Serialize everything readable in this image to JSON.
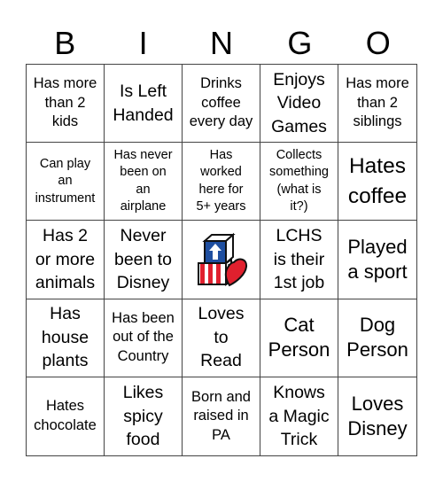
{
  "header": {
    "letters": [
      "B",
      "I",
      "N",
      "G",
      "O"
    ]
  },
  "free_space": {
    "icon": "toy-blocks-heart-logo",
    "colors": {
      "blue": "#1f4fa0",
      "red": "#e0202e",
      "white": "#ffffff",
      "outline": "#111111"
    }
  },
  "cells": [
    {
      "text": "Has more\nthan 2\nkids",
      "size": "m"
    },
    {
      "text": "Is Left\nHanded",
      "size": "l"
    },
    {
      "text": "Drinks\ncoffee\nevery day",
      "size": "m"
    },
    {
      "text": "Enjoys\nVideo\nGames",
      "size": "l"
    },
    {
      "text": "Has more\nthan 2\nsiblings",
      "size": "m"
    },
    {
      "text": "Can play\nan\ninstrument",
      "size": "s"
    },
    {
      "text": "Has never\nbeen on\nan\nairplane",
      "size": "s"
    },
    {
      "text": "Has\nworked\nhere for\n5+ years",
      "size": "s"
    },
    {
      "text": "Collects\nsomething\n(what is\nit?)",
      "size": "s"
    },
    {
      "text": "Hates\ncoffee",
      "size": "xxl"
    },
    {
      "text": "Has 2\nor more\nanimals",
      "size": "l"
    },
    {
      "text": "Never\nbeen to\nDisney",
      "size": "l"
    },
    {
      "text": "",
      "size": "free"
    },
    {
      "text": "LCHS\nis their\n1st job",
      "size": "l"
    },
    {
      "text": "Played\na sport",
      "size": "xl"
    },
    {
      "text": "Has\nhouse\nplants",
      "size": "l"
    },
    {
      "text": "Has been\nout of the\nCountry",
      "size": "m"
    },
    {
      "text": "Loves\nto\nRead",
      "size": "l"
    },
    {
      "text": "Cat\nPerson",
      "size": "xl"
    },
    {
      "text": "Dog\nPerson",
      "size": "xl"
    },
    {
      "text": "Hates\nchocolate",
      "size": "m"
    },
    {
      "text": "Likes\nspicy\nfood",
      "size": "l"
    },
    {
      "text": "Born and\nraised in\nPA",
      "size": "m"
    },
    {
      "text": "Knows\na Magic\nTrick",
      "size": "l"
    },
    {
      "text": "Loves\nDisney",
      "size": "xl"
    }
  ]
}
